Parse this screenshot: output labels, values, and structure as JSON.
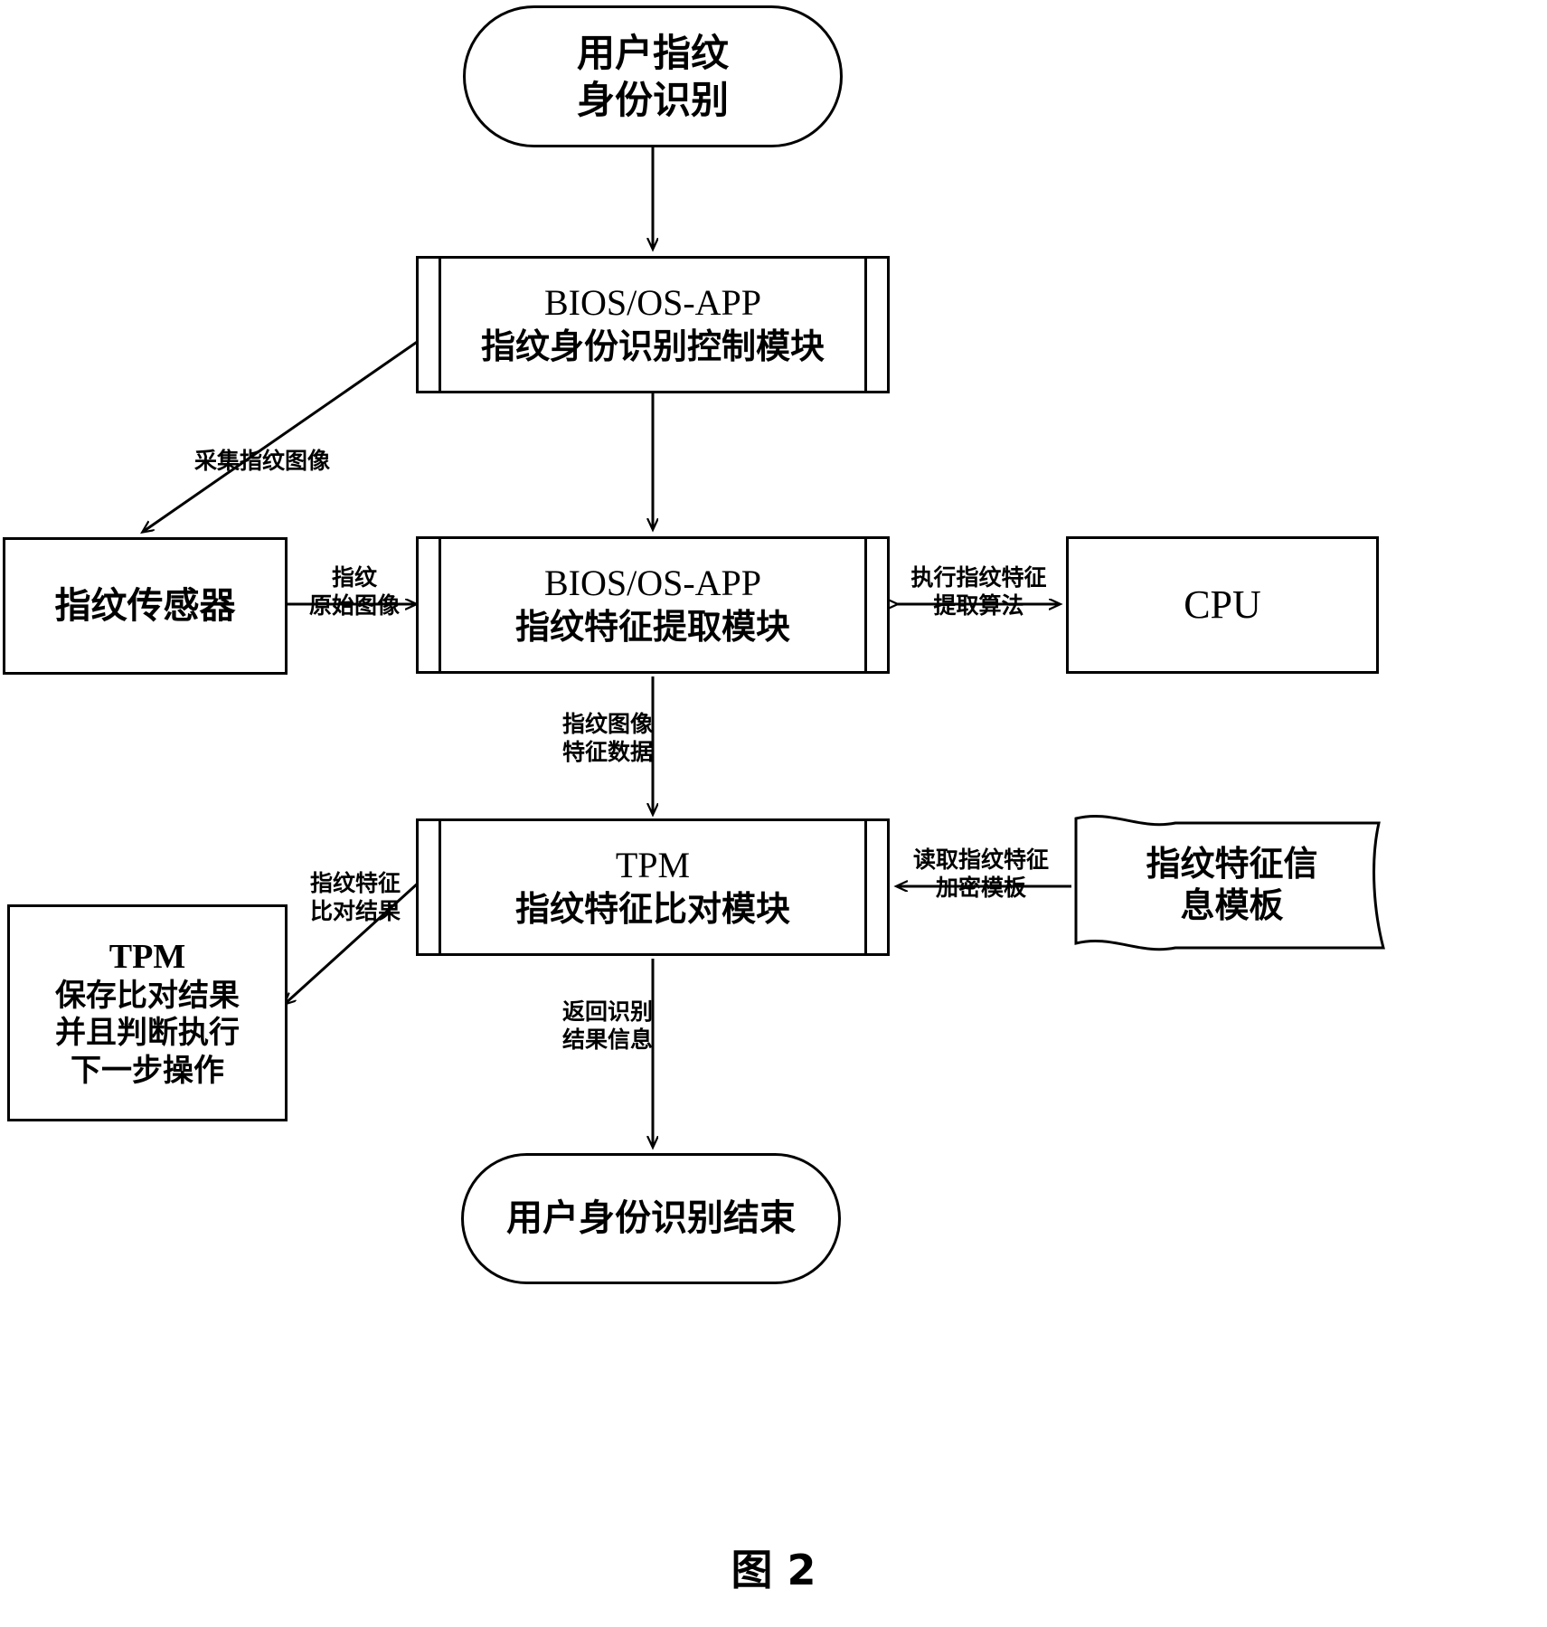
{
  "figure": {
    "caption": "图 2"
  },
  "nodes": {
    "start": {
      "shape": "terminator",
      "lines": [
        "用户指纹",
        "身份识别"
      ]
    },
    "control_module": {
      "shape": "predefined-process",
      "lines": [
        "BIOS/OS-APP",
        "指纹身份识别控制模块"
      ]
    },
    "sensor": {
      "shape": "process",
      "lines": [
        "指纹传感器"
      ]
    },
    "extract_module": {
      "shape": "predefined-process",
      "lines": [
        "BIOS/OS-APP",
        "指纹特征提取模块"
      ]
    },
    "cpu": {
      "shape": "process",
      "lines": [
        "CPU"
      ]
    },
    "compare_module": {
      "shape": "predefined-process",
      "lines": [
        "TPM",
        "指纹特征比对模块"
      ]
    },
    "template_store": {
      "shape": "document",
      "lines": [
        "指纹特征信",
        "息模板"
      ]
    },
    "tpm_save": {
      "shape": "process",
      "lines": [
        "TPM",
        "保存比对结果",
        "并且判断执行",
        "下一步操作"
      ]
    },
    "end": {
      "shape": "terminator",
      "lines": [
        "用户身份识别结束"
      ]
    }
  },
  "edges": {
    "start_to_control": {
      "label_lines": []
    },
    "control_to_sensor": {
      "label_lines": [
        "采集指纹图像"
      ]
    },
    "control_to_extract": {
      "label_lines": []
    },
    "sensor_to_extract": {
      "label_lines": [
        "指纹",
        "原始图像"
      ]
    },
    "extract_to_cpu": {
      "label_lines": [
        "执行指纹特征",
        "提取算法"
      ]
    },
    "extract_to_compare": {
      "label_lines": [
        "指纹图像",
        "特征数据"
      ]
    },
    "template_to_compare": {
      "label_lines": [
        "读取指纹特征",
        "加密模板"
      ]
    },
    "compare_to_tpm_save": {
      "label_lines": [
        "指纹特征",
        "比对结果"
      ]
    },
    "compare_to_end": {
      "label_lines": [
        "返回识别",
        "结果信息"
      ]
    }
  },
  "colors": {
    "stroke": "#000000",
    "background": "#ffffff"
  }
}
